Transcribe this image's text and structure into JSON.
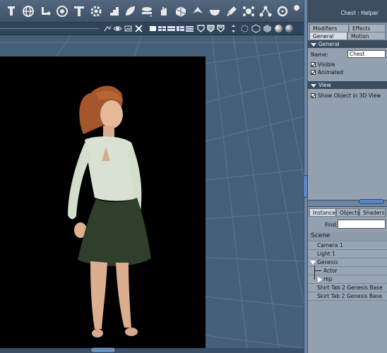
{
  "toolbar": {
    "tools": [
      "translate-tool-icon",
      "rotate-tool-icon",
      "bone-tool-icon",
      "target-tool-icon",
      "text-tool-icon",
      "gear-tool-icon",
      "stairs-tool-icon",
      "leaf-tool-icon",
      "chain-tool-icon",
      "hand-tool-icon",
      "cube-tool-icon",
      "scale-tool-icon",
      "bowl-tool-icon",
      "brush-tool-icon",
      "node-tool-icon",
      "network-tool-icon",
      "ring-tool-icon",
      "wrench-tool-icon"
    ]
  },
  "viewport": {
    "view_icons": [
      "camera-icon",
      "eye-icon",
      "aperture-icon",
      "fit-icon",
      "layout-single-icon",
      "layout-quad-icon",
      "layout-split-icon",
      "layout-triple-icon",
      "shield-icon",
      "shield-shaded-icon",
      "shield-wire-icon",
      "move-view-icon",
      "rotate-view-icon",
      "box-wire-icon",
      "box-solid-icon",
      "sphere-shaded-icon",
      "sphere-textured-icon"
    ]
  },
  "panel": {
    "title": "Chest : Helper",
    "tabs": {
      "modifiers": "Modifiers",
      "effects": "Effects",
      "general": "General",
      "motion": "Motion"
    },
    "general_section": "General",
    "name_label": "Name:",
    "name_value": "Chest",
    "visible_label": "Visible",
    "animated_label": "Animated",
    "view_section": "View",
    "show_object_label": "Show Object in 3D View",
    "lower_tabs": {
      "instances": "Instances",
      "objects": "Objects",
      "shaders": "Shaders"
    },
    "find_label": "Find:",
    "find_value": "",
    "scene_label": "Scene",
    "tree": [
      {
        "label": "Camera 1"
      },
      {
        "label": "Light 1"
      },
      {
        "label": "Genesis"
      },
      {
        "label": "Actor"
      },
      {
        "label": "Hip"
      },
      {
        "label": "Shirt Tab 2 Genesis Base"
      },
      {
        "label": "Skirt Tab 2 Genesis Base"
      }
    ]
  },
  "colors": {
    "accent": "#5b86c1",
    "panel": "#93a0af",
    "toolbar": "#3e5067"
  }
}
